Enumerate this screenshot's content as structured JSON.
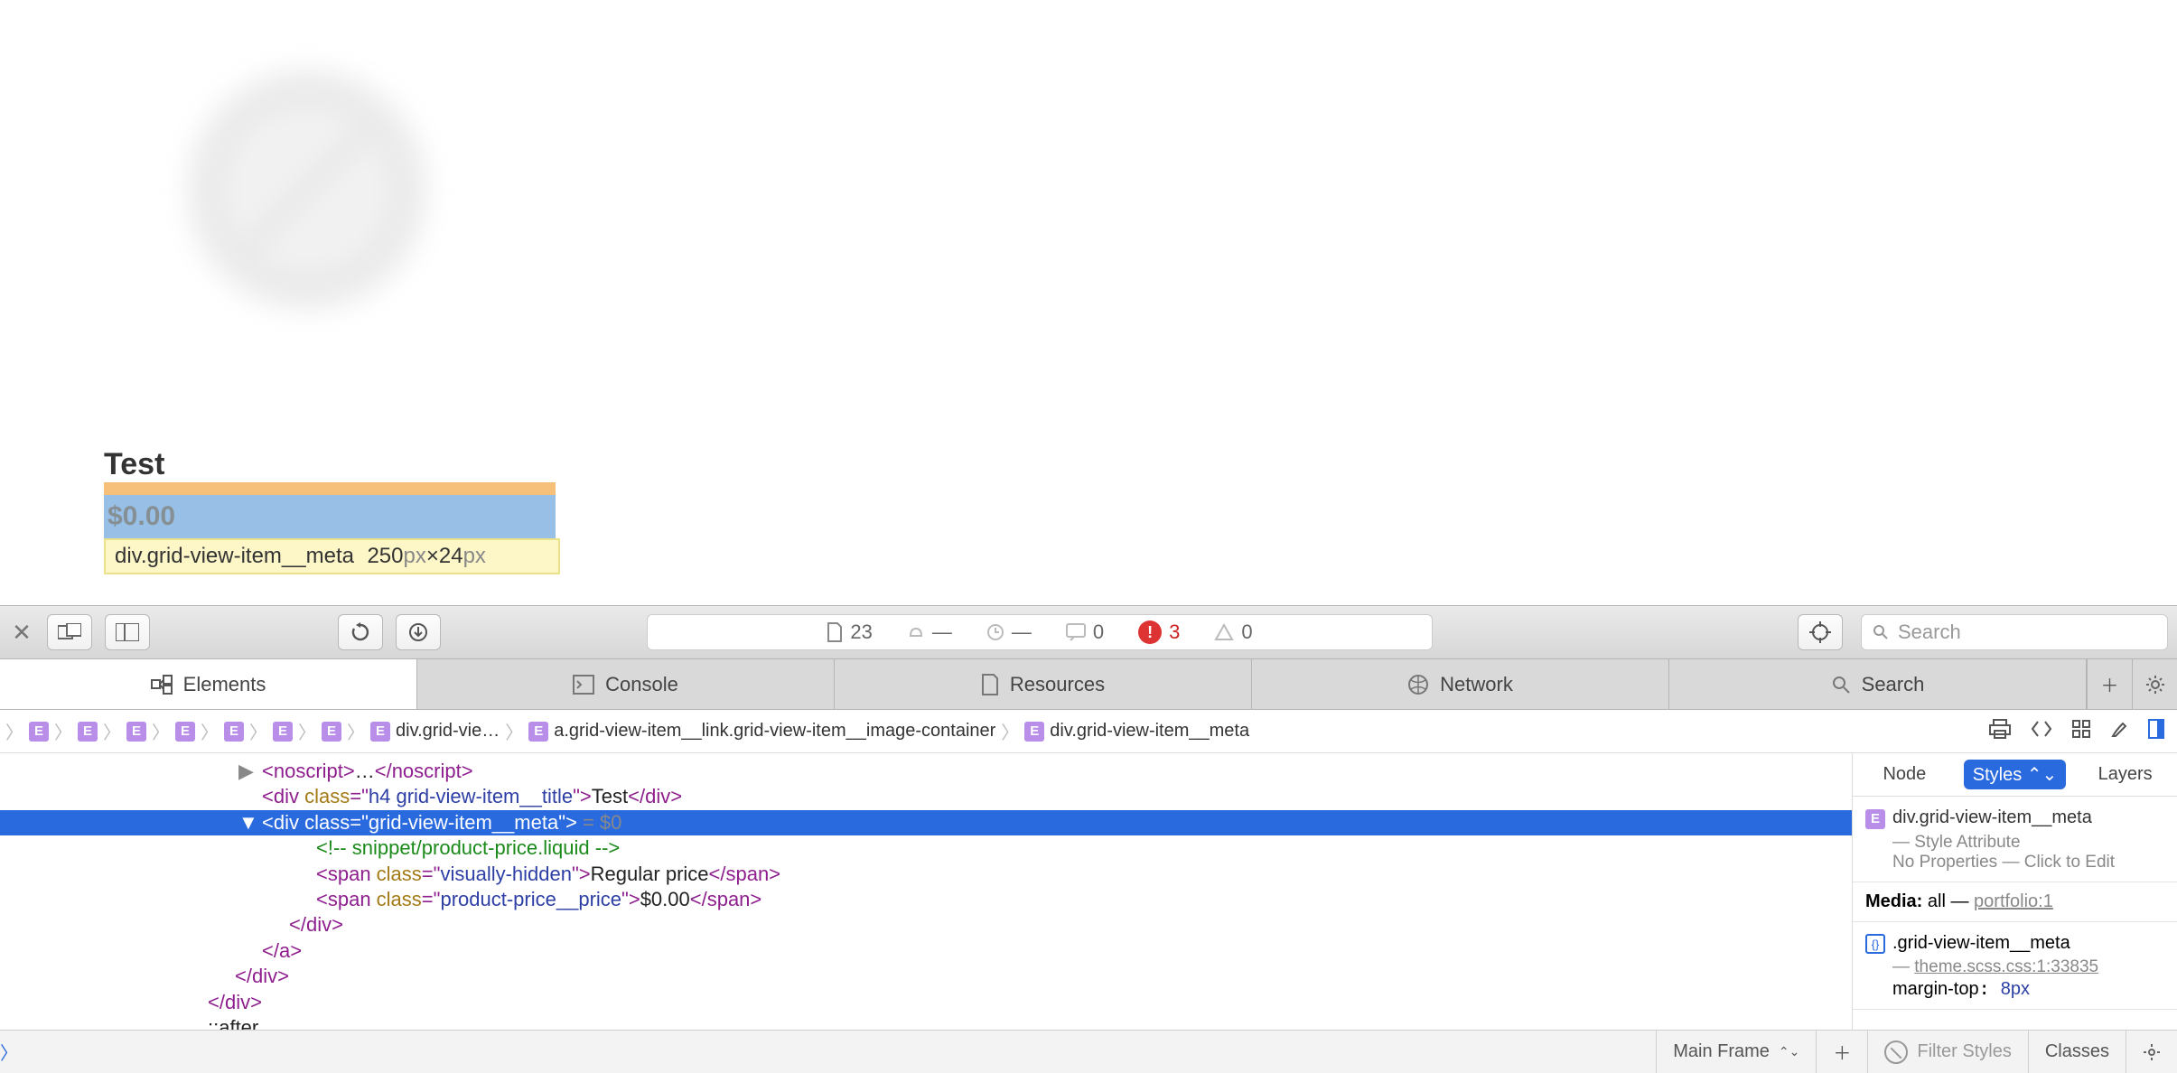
{
  "preview": {
    "title": "Test",
    "price": "$0.00",
    "tooltip_selector": "div.grid-view-item__meta",
    "tooltip_w": "250",
    "tooltip_wu": "px",
    "tooltip_sep": " × ",
    "tooltip_h": "24",
    "tooltip_hu": "px"
  },
  "toolbar": {
    "status_doc_count": "23",
    "status_time": "—",
    "status_clock": "—",
    "status_msgs": "0",
    "status_errors": "3",
    "status_warnings": "0",
    "search_placeholder": "Search"
  },
  "tabs": {
    "elements": "Elements",
    "console": "Console",
    "resources": "Resources",
    "network": "Network",
    "search": "Search"
  },
  "crumbs": {
    "c1": "div.grid-vie…",
    "c2": "a.grid-view-item__link.grid-view-item__image-container",
    "c3": "div.grid-view-item__meta"
  },
  "code": {
    "l1a": "<noscript>",
    "l1b": "…",
    "l1c": "</noscript>",
    "l2a": "<div ",
    "l2b": "class",
    "l2c": "=\"",
    "l2d": "h4 grid-view-item__title",
    "l2e": "\">",
    "l2f": "Test",
    "l2g": "</div>",
    "l3a": "<div ",
    "l3b": "class",
    "l3c": "=\"",
    "l3d": "grid-view-item__meta",
    "l3e": "\">",
    "l3f": " = $0",
    "l4": "<!-- snippet/product-price.liquid -->",
    "l5a": "<span ",
    "l5b": "class",
    "l5c": "=\"",
    "l5d": "visually-hidden",
    "l5e": "\">",
    "l5f": "Regular price",
    "l5g": "</span>",
    "l6a": "<span ",
    "l6b": "class",
    "l6c": "=\"",
    "l6d": "product-price__price",
    "l6e": "\">",
    "l6f": "$0.00",
    "l6g": "</span>",
    "l7": "</div>",
    "l8": "</a>",
    "l9": "</div>",
    "l10": "</div>",
    "l11": "::after"
  },
  "styles": {
    "tab_node": "Node",
    "tab_styles": "Styles",
    "tab_layers": "Layers",
    "sel": "div.grid-view-item__meta",
    "sub": "— Style Attribute",
    "hint": "No Properties — Click to Edit",
    "media_label": "Media:",
    "media_val": " all — ",
    "media_link": "portfolio:1",
    "rule": ".grid-view-item__meta",
    "rule_src_dash": "— ",
    "rule_src": "theme.scss.css:1:33835",
    "prop_name": "margin-top",
    "prop_val": "8px"
  },
  "bottom": {
    "frame": "Main Frame",
    "filter": "Filter Styles",
    "classes": "Classes"
  }
}
